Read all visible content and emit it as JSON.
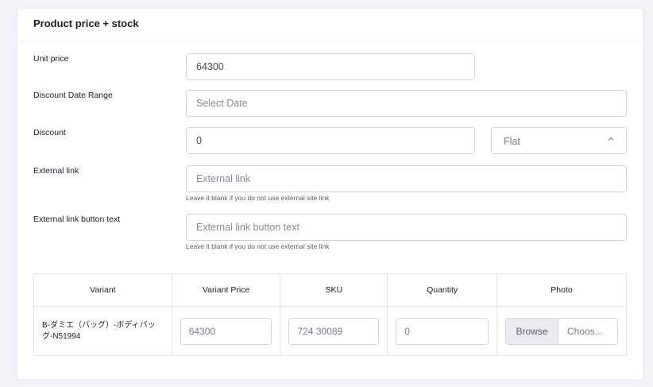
{
  "card": {
    "title": "Product price + stock"
  },
  "fields": {
    "unit_price": {
      "label": "Unit price",
      "value": "64300"
    },
    "discount_date_range": {
      "label": "Discount Date Range",
      "placeholder": "Select Date"
    },
    "discount": {
      "label": "Discount",
      "value": "0",
      "type_selected": "Flat"
    },
    "external_link": {
      "label": "External link",
      "placeholder": "External link",
      "help": "Leave it blank if you do not use external site link"
    },
    "external_link_button_text": {
      "label": "External link button text",
      "placeholder": "External link button text",
      "help": "Leave it blank if you do not use external site link"
    }
  },
  "variants_table": {
    "headers": [
      "Variant",
      "Variant Price",
      "SKU",
      "Quantity",
      "Photo"
    ],
    "rows": [
      {
        "variant": "B-ダミエ（バッグ）-ボディバッグ-N51994",
        "price": "64300",
        "sku": "724 30089",
        "quantity": "0",
        "photo_browse": "Browse",
        "photo_choose": "Choos..."
      }
    ]
  }
}
